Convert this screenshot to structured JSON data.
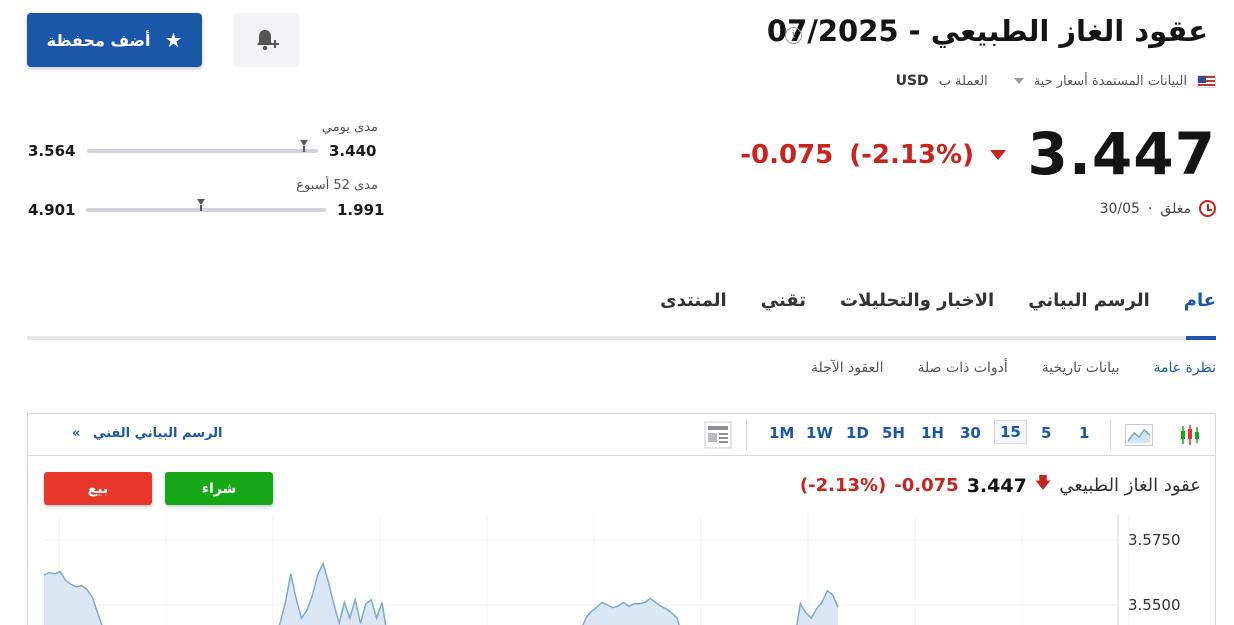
{
  "header": {
    "title": "عقود الغاز الطبيعي - 07/2025",
    "info_icon": "info-icon",
    "flag_icon": "us-flag-icon",
    "data_source": "البيانات المستمدة أسعار حية",
    "currency_label": "العملة ب",
    "currency_value": "USD"
  },
  "actions": {
    "add_portfolio_label": "أضف محفظة",
    "add_portfolio_icon": "star-icon",
    "alert_icon": "bell-plus-icon"
  },
  "quote": {
    "price": "3.447",
    "change": "-0.075",
    "change_pct": "(-2.13%)",
    "status": "مغلق",
    "date": "30/05",
    "status_sep": "·"
  },
  "ranges": {
    "daily": {
      "label": "مدى يومي",
      "low": "3.440",
      "high": "3.564",
      "position": 0.06
    },
    "week52": {
      "label": "مدى 52 أسبوع",
      "low": "1.991",
      "high": "4.901",
      "position": 0.52
    }
  },
  "main_tabs": [
    "عام",
    "الرسم البياني",
    "الاخبار والتحليلات",
    "تقني",
    "المنتدى"
  ],
  "sub_tabs": [
    "نظرة عامة",
    "بيانات تاريخية",
    "أدوات ذات صلة",
    "العقود الآجلة"
  ],
  "chart_toolbar": {
    "timeframes": [
      "1",
      "5",
      "15",
      "30",
      "1H",
      "5H",
      "1D",
      "1W",
      "1M"
    ],
    "active_timeframe": "15",
    "tech_chart_link": "الرسم البياني الفني",
    "tech_chart_arrow": "»"
  },
  "chart_header": {
    "name": "عقود الغاز الطبيعي",
    "price": "3.447",
    "change": "-0.075",
    "change_pct": "(-2.13%)",
    "buy_label": "شراء",
    "sell_label": "بيع"
  },
  "colors": {
    "accent": "#1a57a8",
    "down": "#c8231c",
    "buy": "#17a817",
    "sell": "#e8362a",
    "line": "#7fa9cf",
    "area": "#dbe8f4"
  },
  "chart_data": {
    "type": "area",
    "ylim": [
      3.535,
      3.585
    ],
    "yticks": [
      "3.5750",
      "3.5500"
    ],
    "ytick_values": [
      3.575,
      3.55
    ],
    "values": [
      3.5615,
      3.5625,
      3.562,
      3.5628,
      3.5595,
      3.558,
      3.557,
      3.5575,
      3.556,
      3.553,
      3.547,
      3.541,
      3.538,
      3.538,
      3.538,
      3.538,
      3.538,
      3.538,
      3.538,
      3.538,
      3.538,
      3.538,
      3.538,
      3.538,
      3.538,
      3.538,
      3.538,
      3.538,
      3.538,
      3.538,
      3.538,
      3.538,
      3.538,
      3.538,
      3.538,
      3.538,
      3.538,
      3.538,
      3.538,
      3.538,
      3.538,
      3.538,
      3.538,
      3.538,
      3.543,
      3.551,
      3.562,
      3.5525,
      3.545,
      3.548,
      3.5535,
      3.5615,
      3.566,
      3.559,
      3.5505,
      3.543,
      3.551,
      3.545,
      3.552,
      3.543,
      3.5505,
      3.552,
      3.545,
      3.551,
      3.538,
      3.538,
      3.538,
      3.538,
      3.538,
      3.538,
      3.538,
      3.538,
      3.538,
      3.538,
      3.538,
      3.538,
      3.538,
      3.538,
      3.538,
      3.538,
      3.538,
      3.538,
      3.538,
      3.538,
      3.538,
      3.538,
      3.538,
      3.538,
      3.538,
      3.538,
      3.538,
      3.538,
      3.538,
      3.538,
      3.538,
      3.538,
      3.538,
      3.538,
      3.538,
      3.538,
      3.54,
      3.545,
      3.5475,
      3.549,
      3.551,
      3.55,
      3.549,
      3.5495,
      3.551,
      3.5495,
      3.5505,
      3.5505,
      3.551,
      3.5525,
      3.551,
      3.5495,
      3.5485,
      3.547,
      3.545,
      3.538,
      3.538,
      3.538,
      3.538,
      3.538,
      3.538,
      3.538,
      3.538,
      3.538,
      3.538,
      3.538,
      3.538,
      3.538,
      3.538,
      3.538,
      3.538,
      3.538,
      3.538,
      3.538,
      3.538,
      3.538,
      3.538,
      3.5505,
      3.547,
      3.545,
      3.5485,
      3.551,
      3.5555,
      3.554,
      3.549
    ]
  }
}
